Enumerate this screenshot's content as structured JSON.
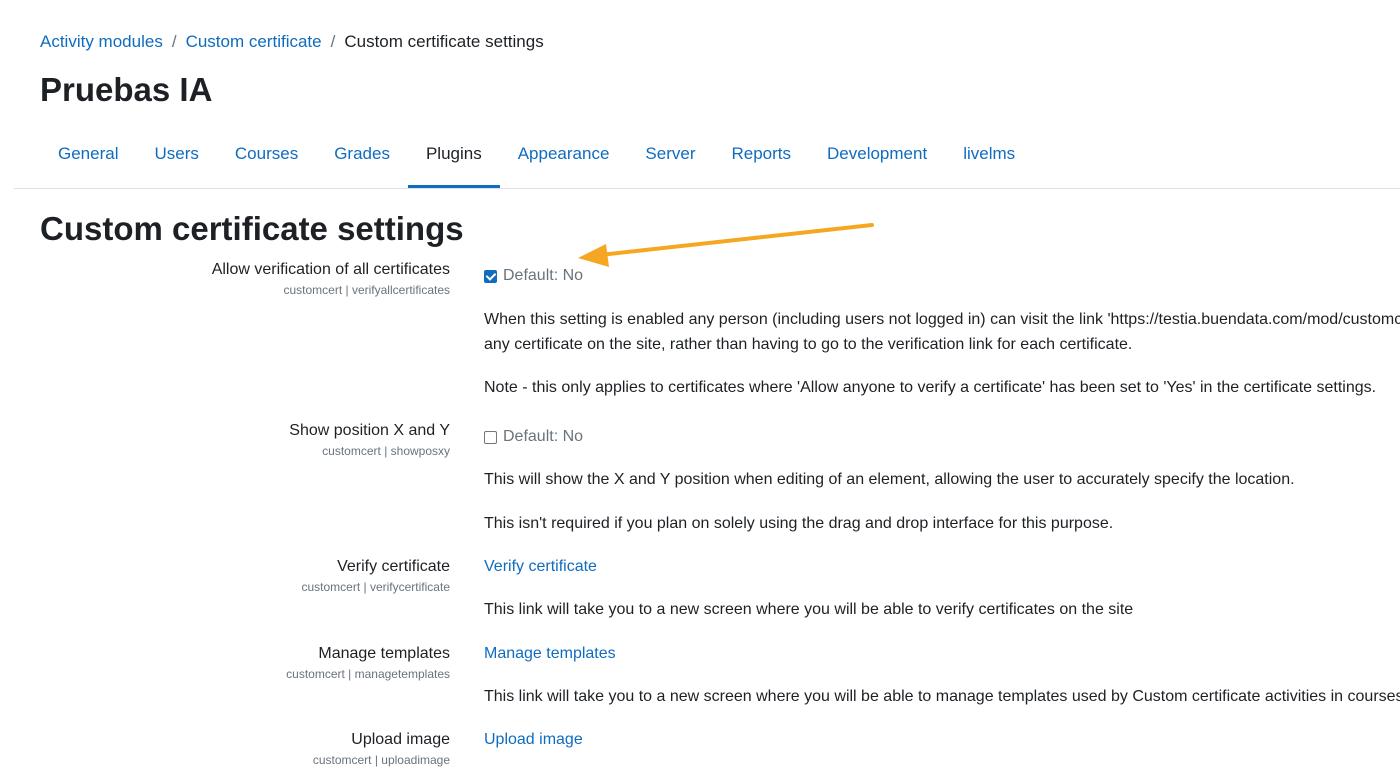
{
  "breadcrumb": {
    "items": [
      "Activity modules",
      "Custom certificate"
    ],
    "current": "Custom certificate settings",
    "separator": "/"
  },
  "site": {
    "title": "Pruebas IA"
  },
  "tabs": [
    {
      "label": "General"
    },
    {
      "label": "Users"
    },
    {
      "label": "Courses"
    },
    {
      "label": "Grades"
    },
    {
      "label": "Plugins",
      "active": true
    },
    {
      "label": "Appearance"
    },
    {
      "label": "Server"
    },
    {
      "label": "Reports"
    },
    {
      "label": "Development"
    },
    {
      "label": "livelms"
    }
  ],
  "page": {
    "heading": "Custom certificate settings"
  },
  "settings": {
    "verifyall": {
      "label": "Allow verification of all certificates",
      "key": "customcert | verifyallcertificates",
      "checked": true,
      "default": "Default: No",
      "desc1a": "When this setting is enabled any person (including users not logged in) can visit the link 'https://testia.buendata.com/mod/customcert/verify_certificate.php' to verify",
      "desc1b": "any certificate on the site, rather than having to go to the verification link for each certificate.",
      "desc2": "Note - this only applies to certificates where 'Allow anyone to verify a certificate' has been set to 'Yes' in the certificate settings."
    },
    "showposxy": {
      "label": "Show position X and Y",
      "key": "customcert | showposxy",
      "checked": false,
      "default": "Default: No",
      "desc1": "This will show the X and Y position when editing of an element, allowing the user to accurately specify the location.",
      "desc2": "This isn't required if you plan on solely using the drag and drop interface for this purpose."
    },
    "verifycert": {
      "label": "Verify certificate",
      "key": "customcert | verifycertificate",
      "link": "Verify certificate",
      "desc": "This link will take you to a new screen where you will be able to verify certificates on the site"
    },
    "managetemplates": {
      "label": "Manage templates",
      "key": "customcert | managetemplates",
      "link": "Manage templates",
      "desc": "This link will take you to a new screen where you will be able to manage templates used by Custom certificate activities in courses."
    },
    "uploadimage": {
      "label": "Upload image",
      "key": "customcert | uploadimage",
      "link": "Upload image"
    }
  },
  "colors": {
    "link": "#0f6cbf",
    "annotation_arrow": "#f5a623",
    "text": "#1d2125",
    "muted": "#6a737b"
  }
}
